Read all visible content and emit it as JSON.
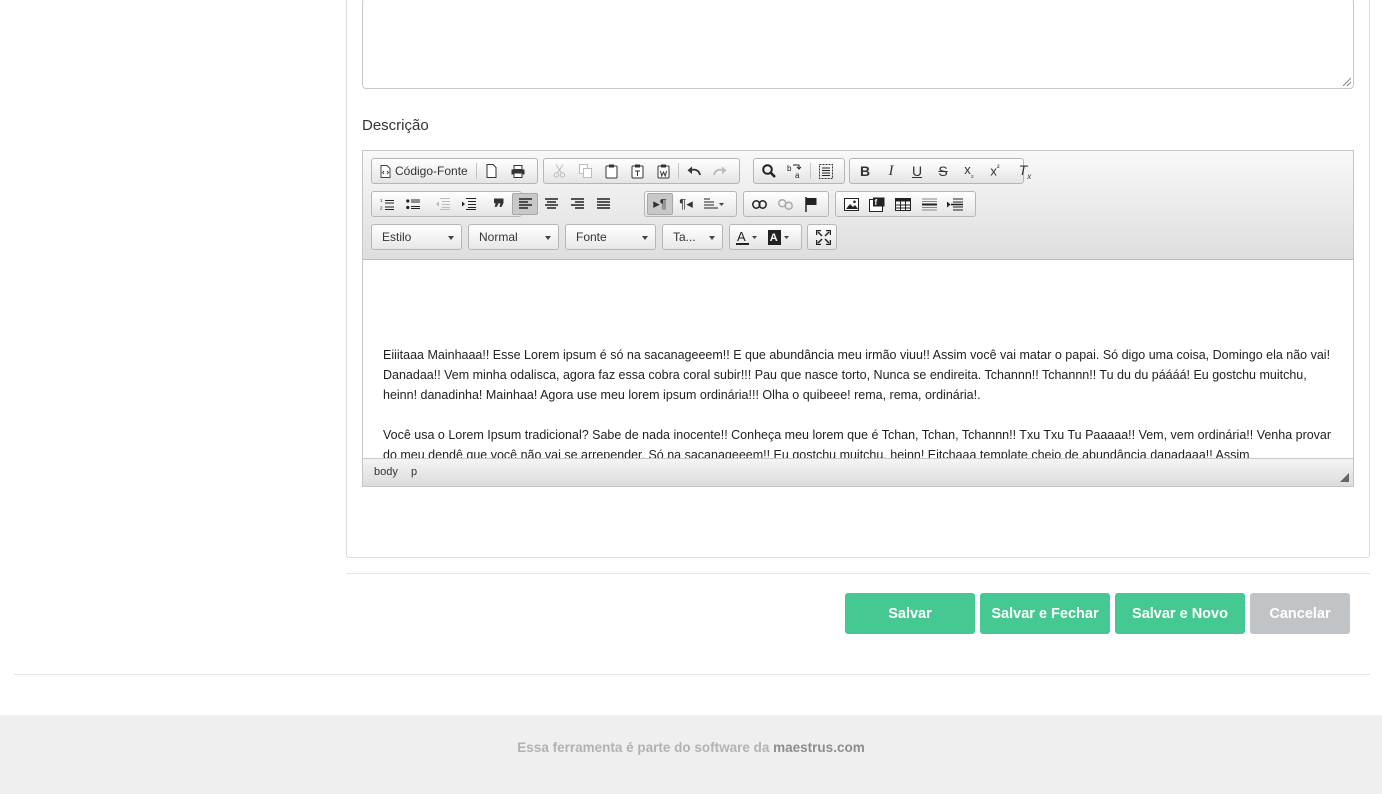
{
  "form": {
    "description_label": "Descrição"
  },
  "editor": {
    "toolbar": {
      "source_label": "Código-Fonte",
      "style_combo": "Estilo",
      "format_combo": "Normal",
      "font_combo": "Fonte",
      "size_combo": "Ta..."
    },
    "paragraphs": [
      "Eiiitaaa Mainhaaa!! Esse Lorem ipsum é só na sacanageeem!! E que abundância meu irmão viuu!! Assim você vai matar o papai. Só digo uma coisa, Domingo ela não vai! Danadaa!! Vem minha odalisca, agora faz essa cobra coral subir!!! Pau que nasce torto, Nunca se endireita. Tchannn!! Tchannn!! Tu du du páááá! Eu gostchu muitchu, heinn! danadinha! Mainhaa! Agora use meu lorem ipsum ordinária!!! Olha o quibeee! rema, rema, ordinária!.",
      "Você usa o Lorem Ipsum tradicional? Sabe de nada inocente!! Conheça meu lorem que é Tchan, Tchan, Tchannn!! Txu Txu Tu Paaaaa!! Vem, vem ordinária!! Venha provar do meu dendê que você não vai se arrepender. Só na sacanageeem!! Eu gostchu muitchu, heinn! Eitchaaa template cheio de abundância danadaaa!! Assim"
    ],
    "path": [
      "body",
      "p"
    ]
  },
  "actions": {
    "save": "Salvar",
    "save_close": "Salvar e Fechar",
    "save_new": "Salvar e Novo",
    "cancel": "Cancelar"
  },
  "footer": {
    "text": "Essa ferramenta é parte do software da ",
    "brand": "maestrus.com"
  },
  "colors": {
    "primary": "#45c892",
    "cancel": "#c1c4c7"
  }
}
